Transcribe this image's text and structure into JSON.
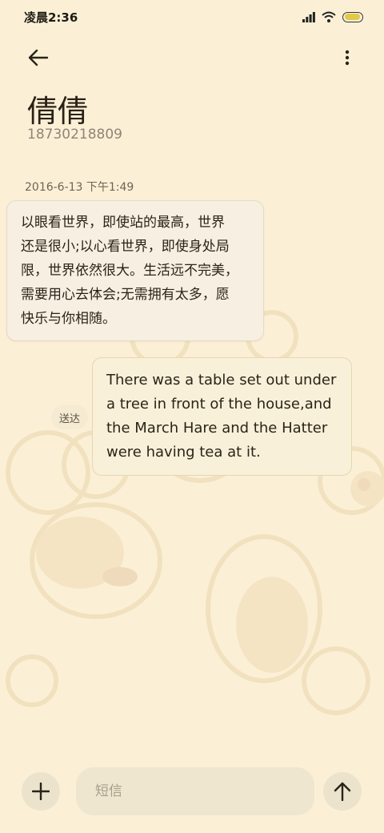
{
  "status_bar": {
    "time": "凌晨2:36",
    "battery_level": 0.95
  },
  "header": {
    "contact_name": "倩倩",
    "contact_phone": "18730218809"
  },
  "conversation": {
    "timestamp": "2016-6-13 下午1:49",
    "incoming": {
      "lines": [
        "以眼看世界，即使站的最高，世界",
        "还是很小;以心看世界，即使身处局",
        "限，世界依然很大。生活远不完美，",
        "需要用心去体会;无需拥有太多，愿",
        "快乐与你相随。"
      ]
    },
    "outgoing": {
      "status": "送达",
      "lines": [
        "There was a table set out under",
        "a tree in front of the house,and",
        "the March Hare and the Hatter",
        "were having tea at it."
      ]
    }
  },
  "composer": {
    "placeholder": "短信"
  },
  "icons": {
    "back": "arrow-left-icon",
    "more": "more-vertical-icon",
    "add": "plus-icon",
    "send": "arrow-up-icon"
  },
  "colors": {
    "background": "#fbf0d6",
    "bubble_in": "#f7efe1",
    "bubble_out": "#f9f0d9",
    "battery": "#e3c94a"
  }
}
